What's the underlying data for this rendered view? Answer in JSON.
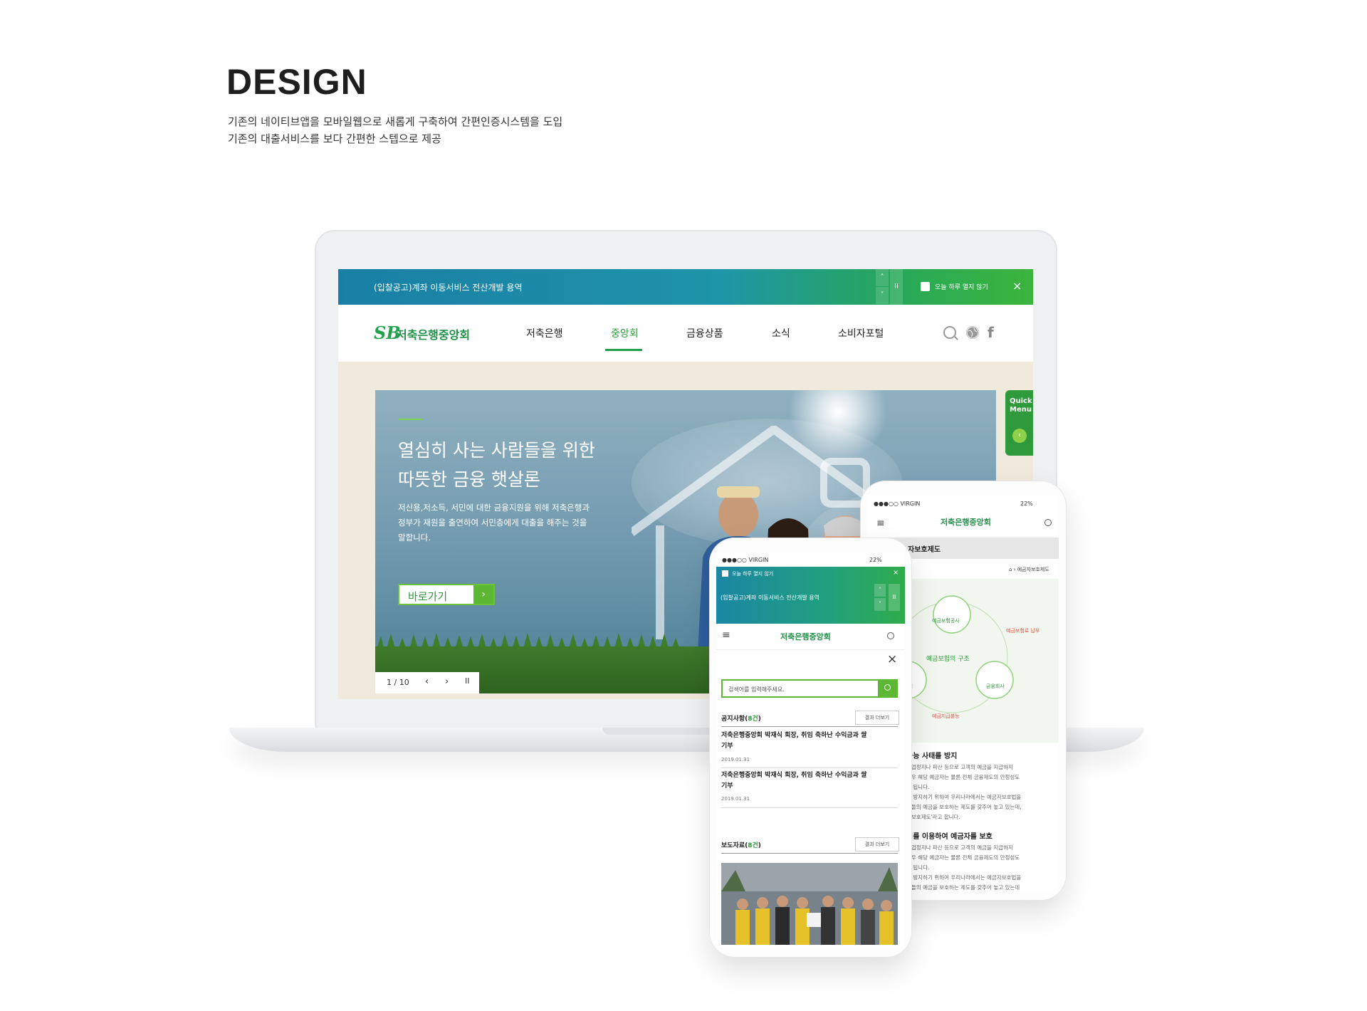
{
  "header": {
    "title": "DESIGN",
    "desc_line1": "기존의 네이티브앱을 모바일웹으로 새롭게 구축하여 간편인증시스템을 도입",
    "desc_line2": "기존의 대출서비스를 보다 간편한 스텝으로 제공"
  },
  "desktop": {
    "notice": {
      "text": "(입찰공고)계좌 이동서비스 전산개발 용역",
      "up": "˄",
      "down": "˅",
      "pause": "II",
      "checkbox_label": "오늘 하루 열지 않기",
      "close": "×"
    },
    "logo": {
      "mark": "SB",
      "text": "저축은행중앙회"
    },
    "nav": [
      {
        "label": "저축은행"
      },
      {
        "label": "중앙회"
      },
      {
        "label": "금융상품"
      },
      {
        "label": "소식"
      },
      {
        "label": "소비자포털"
      }
    ],
    "nav_active_index": 1,
    "social": {
      "facebook": "f"
    },
    "hero": {
      "title_line1": "열심히 사는 사람들을 위한",
      "title_line2": "따뜻한 금융 햇살론",
      "body_line1": "저신용,저소득, 서민에 대한 금융지원을 위해 저축은행과",
      "body_line2": "정부가 재원을 출연하여 서민층에게 대출을 해주는 것을",
      "body_line3": "말합니다.",
      "button": "바로가기",
      "button_arrow": "›"
    },
    "pager": {
      "count": "1 / 10",
      "prev": "‹",
      "next": "›",
      "pause": "II"
    },
    "quick_menu": {
      "line1": "Quick",
      "line2": "Menu",
      "toggle": "‹"
    }
  },
  "phone_back": {
    "status_left": "●●●○○ VIRGIN ",
    "status_right": "22%",
    "menu": "≡",
    "logo": "저축은행중앙회",
    "subtitle": "자보호제도",
    "breadcrumb": "⌂ › 예금자보호제도",
    "diagram": {
      "center": "예금보험의 구조",
      "node_top": "예금보험공사",
      "node_right": "금융회사",
      "node_left": "고객",
      "label_right": "예금보험료 납부",
      "label_left": "지급",
      "label_bottom": "예금지급불능"
    },
    "section1_title": "불능 사태를 방지",
    "section1_lines": [
      "영업정지나 파산 등으로 고객의 예금을 지급하지",
      "경우 해당 예금자는 물론 전체 금융제도의 안정성도",
      "게 됩니다.",
      "를 방지하기 위하여 우리나라에서는 예금자보호법을",
      "객들의 예금을 보호하는 제도를 갖추어 놓고 있는데,",
      "자보호제도'라고 합니다."
    ],
    "section2_title": "리를 이용하여 예금자를 보호",
    "section2_lines": [
      "영업정지나 파산 등으로 고객의 예금을 지급하지",
      "경우 해당 예금자는 물론 전체 금융제도의 안정성도",
      "게 됩니다.",
      "를 방지하기 위하여 우리나라에서는 예금자보호법을",
      "객들의 예금을 보호하는 제도를 갖추어 놓고 있는데"
    ]
  },
  "phone_front": {
    "status_left": "●●●○○ VIRGIN ",
    "status_right": "22%",
    "notice_checkbox_label": "오늘 하루 열지 않기",
    "notice_close": "×",
    "notice_text": "(입찰공고)계좌 이동서비스 전산개발 용역",
    "notice_up": "˄",
    "notice_down": "˅",
    "notice_pause": "II",
    "menu": "≡",
    "logo": "저축은행중앙회",
    "close": "×",
    "search_placeholder": "검색어를 입력해주세요.",
    "notice_section": {
      "label": "공지사항",
      "count": "8건",
      "more": "결과 더보기"
    },
    "items": [
      {
        "title1": "저축은행중앙회 박재식 회장, 취임 축하난 수익금과 쌀",
        "title2": "기부",
        "date": "2019.01.31"
      },
      {
        "title1": "저축은행중앙회 박재식 회장, 취임 축하난 수익금과 쌀",
        "title2": "기부",
        "date": "2019.01.31"
      }
    ],
    "press_section": {
      "label": "보도자료",
      "count": "8건",
      "more": "결과 더보기"
    }
  },
  "colors": {
    "brand_green": "#23a24d",
    "accent_green": "#5cb832",
    "notice_teal": "#1a7fa6"
  }
}
